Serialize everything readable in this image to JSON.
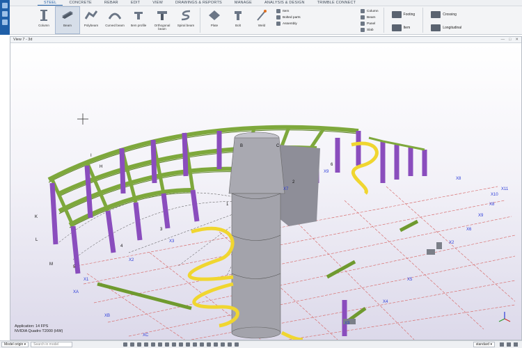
{
  "ribbon": {
    "tabs": [
      "STEEL",
      "CONCRETE",
      "REBAR",
      "EDIT",
      "VIEW",
      "DRAWINGS & REPORTS",
      "MANAGE",
      "ANALYSIS & DESIGN",
      "TRIMBLE CONNECT"
    ],
    "tools": [
      "Column",
      "Beam",
      "Polybeam",
      "Curved beam",
      "Item profile",
      "Orthogonal beam",
      "Spiral beam",
      "Plate",
      "Bolt",
      "Weld"
    ],
    "parts_list": [
      "Item",
      "Bolted parts",
      "Assembly"
    ],
    "concrete_list": [
      "Column",
      "Beam",
      "Panel",
      "Slab"
    ],
    "footing": "Footing",
    "item": "Item",
    "crossing": "Crossing",
    "longitudinal": "Longitudinal"
  },
  "view": {
    "title": "View 7 - 3d",
    "app_info": "Application: 14 FPS",
    "gpu_info": "NVIDIA Quadro T2000 (HW)"
  },
  "grid_labels": {
    "letters": [
      "H",
      "I",
      "J",
      "K",
      "L",
      "M",
      "B",
      "C"
    ],
    "numbers": [
      "1",
      "2",
      "3",
      "4",
      "5",
      "6",
      "7"
    ],
    "x": [
      "X1",
      "X2",
      "X3",
      "X4",
      "X5",
      "X6",
      "X7",
      "X8",
      "X9",
      "X10",
      "X11",
      "XA",
      "XB",
      "XC"
    ]
  },
  "status": {
    "model_origin": "Model origin",
    "search_placeholder": "Search in model",
    "standard": "standard"
  },
  "colors": {
    "steel_green": "#7ea83c",
    "column_purple": "#8a4dbd",
    "spiral_yellow": "#f0d630",
    "concrete_gray": "#a9a9b1",
    "grid_red": "#d87070",
    "label_blue": "#2b3bd9"
  }
}
